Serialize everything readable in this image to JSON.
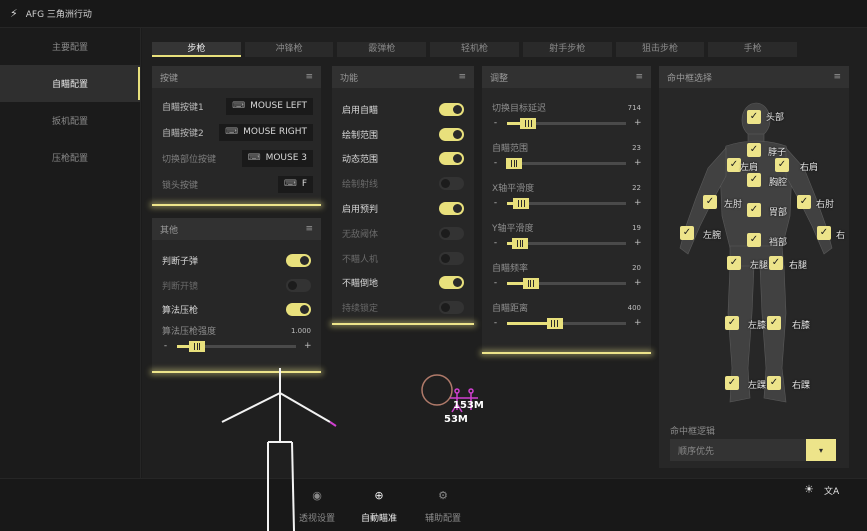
{
  "app": {
    "logo": "⚡",
    "title": "AFG 三角洲行动"
  },
  "sidebar": {
    "items": [
      {
        "label": "主要配置",
        "active": false
      },
      {
        "label": "自瞄配置",
        "active": true
      },
      {
        "label": "扳机配置",
        "active": false
      },
      {
        "label": "压枪配置",
        "active": false
      }
    ]
  },
  "tabs": [
    {
      "label": "步枪",
      "active": true
    },
    {
      "label": "冲锋枪",
      "active": false
    },
    {
      "label": "霰弹枪",
      "active": false
    },
    {
      "label": "轻机枪",
      "active": false
    },
    {
      "label": "射手步枪",
      "active": false
    },
    {
      "label": "狙击步枪",
      "active": false
    },
    {
      "label": "手枪",
      "active": false
    }
  ],
  "keys_panel": {
    "title": "按键",
    "menu_icon": "≡",
    "rows": [
      {
        "label": "自瞄按键1",
        "kbd": "⌨",
        "key": "MOUSE LEFT",
        "dim": false
      },
      {
        "label": "自瞄按键2",
        "kbd": "⌨",
        "key": "MOUSE RIGHT",
        "dim": false
      },
      {
        "label": "切换部位按键",
        "kbd": "⌨",
        "key": "MOUSE 3",
        "dim": true
      },
      {
        "label": "锁头按键",
        "kbd": "⌨",
        "key": "F",
        "dim": true
      }
    ]
  },
  "other_panel": {
    "title": "其他",
    "menu_icon": "≡",
    "toggles": [
      {
        "label": "判断子弹",
        "on": true
      },
      {
        "label": "判断开镜",
        "on": false
      },
      {
        "label": "算法压枪",
        "on": true
      }
    ],
    "slider": {
      "label": "算法压枪强度",
      "value": "1.000",
      "level": 0.17,
      "minus": "-",
      "plus": "+"
    }
  },
  "func_panel": {
    "title": "功能",
    "menu_icon": "≡",
    "toggles": [
      {
        "label": "启用自瞄",
        "on": true
      },
      {
        "label": "绘制范围",
        "on": true
      },
      {
        "label": "动态范围",
        "on": true
      },
      {
        "label": "绘制射线",
        "on": false
      },
      {
        "label": "启用预判",
        "on": true
      },
      {
        "label": "无敌阈体",
        "on": false
      },
      {
        "label": "不瞄人机",
        "on": false
      },
      {
        "label": "不瞄倒地",
        "on": true
      },
      {
        "label": "持续锁定",
        "on": false
      }
    ]
  },
  "adjust_panel": {
    "title": "调整",
    "menu_icon": "≡",
    "sliders": [
      {
        "label": "切换目标延迟",
        "value": "714",
        "level": 0.18,
        "minus": "-",
        "plus": "+"
      },
      {
        "label": "自瞄范围",
        "value": "23",
        "level": 0.06,
        "minus": "-",
        "plus": "+"
      },
      {
        "label": "X轴平滑度",
        "value": "22",
        "level": 0.12,
        "minus": "-",
        "plus": "+"
      },
      {
        "label": "Y轴平滑度",
        "value": "19",
        "level": 0.11,
        "minus": "-",
        "plus": "+"
      },
      {
        "label": "自瞄频率",
        "value": "20",
        "level": 0.2,
        "minus": "-",
        "plus": "+"
      },
      {
        "label": "自瞄距离",
        "value": "400",
        "level": 0.4,
        "minus": "-",
        "plus": "+"
      }
    ]
  },
  "hitbox_panel": {
    "title": "命中框选择",
    "menu_icon": "≡",
    "check": "✓",
    "parts": [
      {
        "label": "头部",
        "checked": true
      },
      {
        "label": "脖子",
        "checked": true
      },
      {
        "label": "左肩",
        "checked": true
      },
      {
        "label": "右肩",
        "checked": true
      },
      {
        "label": "胸腔",
        "checked": true
      },
      {
        "label": "左肘",
        "checked": true
      },
      {
        "label": "右肘",
        "checked": true
      },
      {
        "label": "胃部",
        "checked": true
      },
      {
        "label": "左腕",
        "checked": true
      },
      {
        "label": "右",
        "checked": true
      },
      {
        "label": "裆部",
        "checked": true
      },
      {
        "label": "左腿",
        "checked": true
      },
      {
        "label": "右腿",
        "checked": true
      },
      {
        "label": "左膝",
        "checked": true
      },
      {
        "label": "右膝",
        "checked": true
      },
      {
        "label": "左踝",
        "checked": true
      },
      {
        "label": "右踝",
        "checked": true
      }
    ],
    "logic_label": "命中框逻辑",
    "logic_value": "顺序优先",
    "dropdown_icon": "▾"
  },
  "bottom_nav": [
    {
      "icon": "◉",
      "icon_name": "eye-icon",
      "label": "透视设置",
      "active": false
    },
    {
      "icon": "⊕",
      "icon_name": "crosshair-icon",
      "label": "自動瞄准",
      "active": true
    },
    {
      "icon": "⚙",
      "icon_name": "gear-icon",
      "label": "辅助配置",
      "active": false
    }
  ],
  "utilities": {
    "theme_icon": "☀",
    "translate_icon": "文A"
  },
  "esp": {
    "dist1": "153M",
    "dist2": "53M"
  },
  "colors": {
    "accent": "#ede48a",
    "background": "#1b1b1b",
    "panel": "#272727",
    "esp_magenta": "#d040d0"
  }
}
